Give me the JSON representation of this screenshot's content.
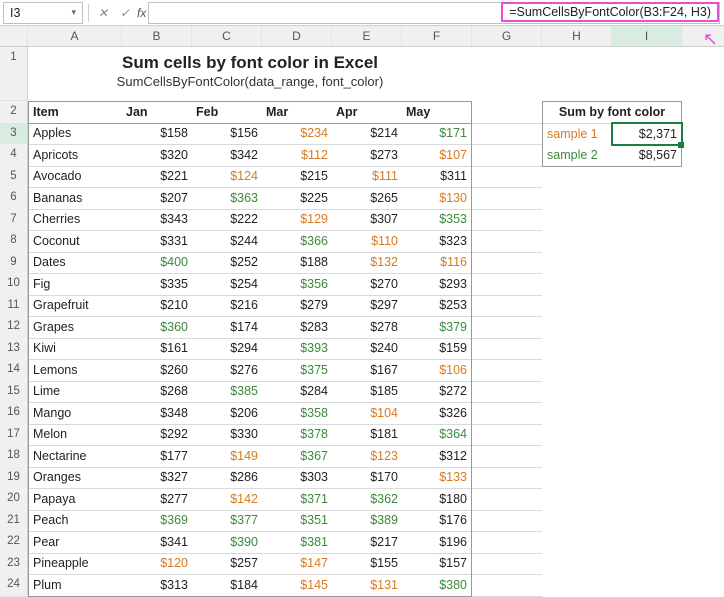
{
  "namebox": "I3",
  "formula": "=SumCellsByFontColor(B3:F24, H3)",
  "columns": [
    "A",
    "B",
    "C",
    "D",
    "E",
    "F",
    "G",
    "H",
    "I"
  ],
  "title": "Sum cells by font color in Excel",
  "subtitle": "SumCellsByFontColor(data_range, font_color)",
  "headers": {
    "item": "Item",
    "m1": "Jan",
    "m2": "Feb",
    "m3": "Mar",
    "m4": "Apr",
    "m5": "May"
  },
  "side": {
    "heading": "Sum by font color",
    "r1_label": "sample 1",
    "r1_color": "orange",
    "r1_val": "$2,371",
    "r2_label": "sample 2",
    "r2_color": "green",
    "r2_val": "$8,567"
  },
  "rows": [
    {
      "n": 3,
      "item": "Apples",
      "v": [
        [
          "$158",
          ""
        ],
        [
          "$156",
          ""
        ],
        [
          "$234",
          "o"
        ],
        [
          "$214",
          ""
        ],
        [
          "$171",
          "g"
        ]
      ]
    },
    {
      "n": 4,
      "item": "Apricots",
      "v": [
        [
          "$320",
          ""
        ],
        [
          "$342",
          ""
        ],
        [
          "$112",
          "o"
        ],
        [
          "$273",
          ""
        ],
        [
          "$107",
          "o"
        ]
      ]
    },
    {
      "n": 5,
      "item": "Avocado",
      "v": [
        [
          "$221",
          ""
        ],
        [
          "$124",
          "o"
        ],
        [
          "$215",
          ""
        ],
        [
          "$111",
          "o"
        ],
        [
          "$311",
          ""
        ]
      ]
    },
    {
      "n": 6,
      "item": "Bananas",
      "v": [
        [
          "$207",
          ""
        ],
        [
          "$363",
          "g"
        ],
        [
          "$225",
          ""
        ],
        [
          "$265",
          ""
        ],
        [
          "$130",
          "o"
        ]
      ]
    },
    {
      "n": 7,
      "item": "Cherries",
      "v": [
        [
          "$343",
          ""
        ],
        [
          "$222",
          ""
        ],
        [
          "$129",
          "o"
        ],
        [
          "$307",
          ""
        ],
        [
          "$353",
          "g"
        ]
      ]
    },
    {
      "n": 8,
      "item": "Coconut",
      "v": [
        [
          "$331",
          ""
        ],
        [
          "$244",
          ""
        ],
        [
          "$366",
          "g"
        ],
        [
          "$110",
          "o"
        ],
        [
          "$323",
          ""
        ]
      ]
    },
    {
      "n": 9,
      "item": "Dates",
      "v": [
        [
          "$400",
          "g"
        ],
        [
          "$252",
          ""
        ],
        [
          "$188",
          ""
        ],
        [
          "$132",
          "o"
        ],
        [
          "$116",
          "o"
        ]
      ]
    },
    {
      "n": 10,
      "item": "Fig",
      "v": [
        [
          "$335",
          ""
        ],
        [
          "$254",
          ""
        ],
        [
          "$356",
          "g"
        ],
        [
          "$270",
          ""
        ],
        [
          "$293",
          ""
        ]
      ]
    },
    {
      "n": 11,
      "item": "Grapefruit",
      "v": [
        [
          "$210",
          ""
        ],
        [
          "$216",
          ""
        ],
        [
          "$279",
          ""
        ],
        [
          "$297",
          ""
        ],
        [
          "$253",
          ""
        ]
      ]
    },
    {
      "n": 12,
      "item": "Grapes",
      "v": [
        [
          "$360",
          "g"
        ],
        [
          "$174",
          ""
        ],
        [
          "$283",
          ""
        ],
        [
          "$278",
          ""
        ],
        [
          "$379",
          "g"
        ]
      ]
    },
    {
      "n": 13,
      "item": "Kiwi",
      "v": [
        [
          "$161",
          ""
        ],
        [
          "$294",
          ""
        ],
        [
          "$393",
          "g"
        ],
        [
          "$240",
          ""
        ],
        [
          "$159",
          ""
        ]
      ]
    },
    {
      "n": 14,
      "item": "Lemons",
      "v": [
        [
          "$260",
          ""
        ],
        [
          "$276",
          ""
        ],
        [
          "$375",
          "g"
        ],
        [
          "$167",
          ""
        ],
        [
          "$106",
          "o"
        ]
      ]
    },
    {
      "n": 15,
      "item": "Lime",
      "v": [
        [
          "$268",
          ""
        ],
        [
          "$385",
          "g"
        ],
        [
          "$284",
          ""
        ],
        [
          "$185",
          ""
        ],
        [
          "$272",
          ""
        ]
      ]
    },
    {
      "n": 16,
      "item": "Mango",
      "v": [
        [
          "$348",
          ""
        ],
        [
          "$206",
          ""
        ],
        [
          "$358",
          "g"
        ],
        [
          "$104",
          "o"
        ],
        [
          "$326",
          ""
        ]
      ]
    },
    {
      "n": 17,
      "item": "Melon",
      "v": [
        [
          "$292",
          ""
        ],
        [
          "$330",
          ""
        ],
        [
          "$378",
          "g"
        ],
        [
          "$181",
          ""
        ],
        [
          "$364",
          "g"
        ]
      ]
    },
    {
      "n": 18,
      "item": "Nectarine",
      "v": [
        [
          "$177",
          ""
        ],
        [
          "$149",
          "o"
        ],
        [
          "$367",
          "g"
        ],
        [
          "$123",
          "o"
        ],
        [
          "$312",
          ""
        ]
      ]
    },
    {
      "n": 19,
      "item": "Oranges",
      "v": [
        [
          "$327",
          ""
        ],
        [
          "$286",
          ""
        ],
        [
          "$303",
          ""
        ],
        [
          "$170",
          ""
        ],
        [
          "$133",
          "o"
        ]
      ]
    },
    {
      "n": 20,
      "item": "Papaya",
      "v": [
        [
          "$277",
          ""
        ],
        [
          "$142",
          "o"
        ],
        [
          "$371",
          "g"
        ],
        [
          "$362",
          "g"
        ],
        [
          "$180",
          ""
        ]
      ]
    },
    {
      "n": 21,
      "item": "Peach",
      "v": [
        [
          "$369",
          "g"
        ],
        [
          "$377",
          "g"
        ],
        [
          "$351",
          "g"
        ],
        [
          "$389",
          "g"
        ],
        [
          "$176",
          ""
        ]
      ]
    },
    {
      "n": 22,
      "item": "Pear",
      "v": [
        [
          "$341",
          ""
        ],
        [
          "$390",
          "g"
        ],
        [
          "$381",
          "g"
        ],
        [
          "$217",
          ""
        ],
        [
          "$196",
          ""
        ]
      ]
    },
    {
      "n": 23,
      "item": "Pineapple",
      "v": [
        [
          "$120",
          "o"
        ],
        [
          "$257",
          ""
        ],
        [
          "$147",
          "o"
        ],
        [
          "$155",
          ""
        ],
        [
          "$157",
          ""
        ]
      ]
    },
    {
      "n": 24,
      "item": "Plum",
      "v": [
        [
          "$313",
          ""
        ],
        [
          "$184",
          ""
        ],
        [
          "$145",
          "o"
        ],
        [
          "$131",
          "o"
        ],
        [
          "$380",
          "g"
        ]
      ]
    }
  ]
}
